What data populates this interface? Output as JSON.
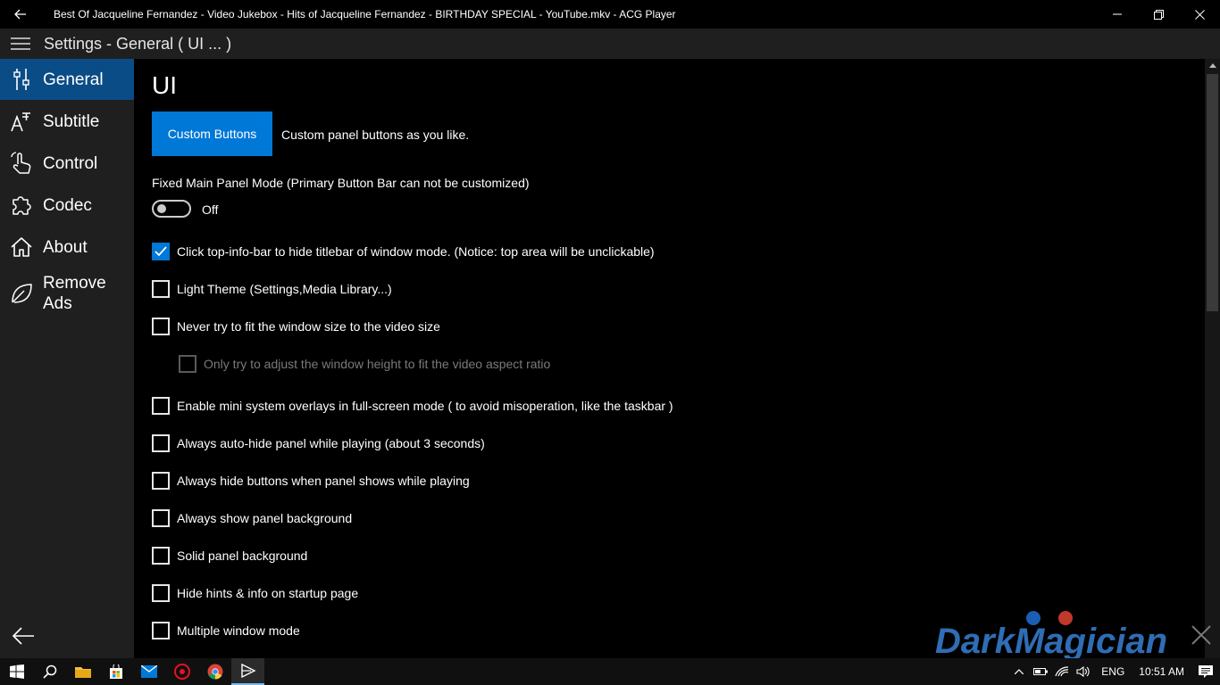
{
  "titlebar": {
    "title": "Best Of Jacqueline Fernandez - Video Jukebox - Hits of Jacqueline Fernandez - BIRTHDAY SPECIAL - YouTube.mkv - ACG Player"
  },
  "header": {
    "title": "Settings  - General ( UI ... )"
  },
  "sidebar": {
    "items": [
      {
        "label": "General",
        "icon": "sliders-icon",
        "active": true
      },
      {
        "label": "Subtitle",
        "icon": "subtitle-icon",
        "active": false
      },
      {
        "label": "Control",
        "icon": "hand-pointer-icon",
        "active": false
      },
      {
        "label": "Codec",
        "icon": "puzzle-icon",
        "active": false
      },
      {
        "label": "About",
        "icon": "home-icon",
        "active": false
      },
      {
        "label": "Remove Ads",
        "label_line1": "Remove",
        "label_line2": "Ads",
        "icon": "leaf-icon",
        "active": false
      }
    ]
  },
  "main": {
    "heading": "UI",
    "custom_button_label": "Custom Buttons",
    "custom_button_desc": "Custom panel buttons as you like.",
    "fixed_mode_label": "Fixed Main Panel Mode (Primary Button Bar can not be customized)",
    "fixed_mode_state": "Off",
    "checkboxes": [
      {
        "label": "Click top-info-bar to hide titlebar of window mode. (Notice: top area will be unclickable)",
        "checked": true
      },
      {
        "label": "Light Theme (Settings,Media Library...)",
        "checked": false
      },
      {
        "label": "Never try to fit the window size to the video size",
        "checked": false
      },
      {
        "label": "Only try to adjust the window height to fit the video aspect ratio",
        "checked": false,
        "disabled": true
      },
      {
        "label": "Enable mini system overlays in full-screen mode ( to avoid misoperation, like the taskbar )",
        "checked": false
      },
      {
        "label": "Always auto-hide panel while playing (about 3 seconds)",
        "checked": false
      },
      {
        "label": "Always hide buttons when panel shows while playing",
        "checked": false
      },
      {
        "label": "Always show panel background",
        "checked": false
      },
      {
        "label": "Solid panel background",
        "checked": false
      },
      {
        "label": "Hide hints & info on startup page",
        "checked": false
      },
      {
        "label": "Multiple window mode",
        "checked": false
      }
    ]
  },
  "watermark": {
    "text": "DarkMagician"
  },
  "taskbar": {
    "language": "ENG",
    "time": "10:51 AM"
  },
  "colors": {
    "accent": "#0078d7",
    "sidebar_active": "#0a4c86",
    "sidebar_bg": "#1f1f1f",
    "main_bg": "#000000"
  }
}
